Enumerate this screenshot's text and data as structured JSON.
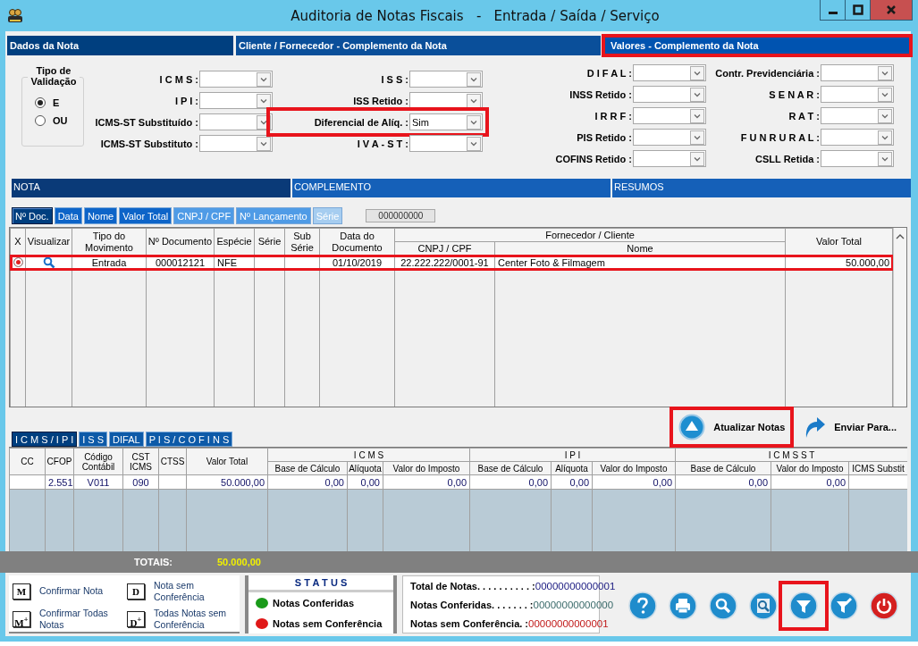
{
  "window": {
    "title": "Auditoria de Notas Fiscais   -   Entrada / Saída / Serviço"
  },
  "sections": [
    {
      "label": "Dados da Nota",
      "highlighted": false
    },
    {
      "label": "Cliente / Fornecedor - Complemento da Nota",
      "highlighted": false
    },
    {
      "label": "Valores - Complemento da Nota",
      "highlighted": true
    }
  ],
  "validation": {
    "title": "Tipo de Validação",
    "options": [
      {
        "label": "E",
        "selected": true
      },
      {
        "label": "OU",
        "selected": false
      }
    ]
  },
  "filters": [
    [
      {
        "label": "I C M S :",
        "highlighted": false
      },
      {
        "label": "I P I :",
        "highlighted": false
      },
      {
        "label": "ICMS-ST Substituído :",
        "highlighted": false
      },
      {
        "label": "ICMS-ST Substituto :",
        "highlighted": false
      }
    ],
    [
      {
        "label": "I S S :",
        "highlighted": false
      },
      {
        "label": "ISS Retido :",
        "highlighted": false
      },
      {
        "label": "Diferencial de Alíq. :",
        "value": "Sim",
        "highlighted": true
      },
      {
        "label": "I V A - S T :",
        "highlighted": false
      }
    ],
    [
      {
        "label": "D I F A L :",
        "highlighted": false
      },
      {
        "label": "INSS Retido :",
        "highlighted": false
      },
      {
        "label": "I R R F :",
        "highlighted": false
      },
      {
        "label": "PIS Retido :",
        "highlighted": false
      },
      {
        "label": "COFINS Retido :",
        "highlighted": false
      }
    ],
    [
      {
        "label": "Contr. Previdenciária :",
        "highlighted": false
      },
      {
        "label": "S E N A R :",
        "highlighted": false
      },
      {
        "label": "R A T :",
        "highlighted": false
      },
      {
        "label": "F U N R U R A L :",
        "highlighted": false
      },
      {
        "label": "CSLL Retida :",
        "highlighted": false
      }
    ]
  ],
  "result_tabs": [
    {
      "label": "NOTA",
      "selected": true
    },
    {
      "label": "COMPLEMENTO",
      "selected": false
    },
    {
      "label": "RESUMOS",
      "selected": false
    }
  ],
  "sort_tabs": [
    {
      "label": "Nº Doc.",
      "selected": true,
      "color": "#003f7f"
    },
    {
      "label": "Data",
      "selected": false,
      "color": "#0d64c8"
    },
    {
      "label": "Nome",
      "selected": false,
      "color": "#0d64c8"
    },
    {
      "label": "Valor Total",
      "selected": false,
      "color": "#0d64c8"
    },
    {
      "label": "CNPJ / CPF",
      "selected": false,
      "color": "#4f9be6"
    },
    {
      "label": "Nº Lançamento",
      "selected": false,
      "color": "#4f9be6"
    },
    {
      "label": "Série",
      "selected": false,
      "color": "#a6cdf0"
    }
  ],
  "sort_field": {
    "value": "000000000"
  },
  "grid": {
    "columns": [
      {
        "header": "X",
        "kind": "radio"
      },
      {
        "header": "Visualizar",
        "kind": "icon"
      },
      {
        "header": "Tipo do Movimento",
        "kind": "text"
      },
      {
        "header": "Nº Documento",
        "kind": "text"
      },
      {
        "header": "Espécie",
        "kind": "name"
      },
      {
        "header": "Série",
        "kind": "text"
      },
      {
        "header": "Sub Série",
        "kind": "text"
      },
      {
        "header": "Data do Documento",
        "kind": "text"
      },
      {
        "header": "Fornecedor / Cliente",
        "colspan": 2,
        "children": [
          {
            "header": "CNPJ / CPF",
            "kind": "text"
          },
          {
            "header": "Nome",
            "kind": "name"
          }
        ]
      },
      {
        "header": "Valor Total",
        "kind": "number"
      }
    ],
    "rows": [
      {
        "selected": true,
        "highlighted": true,
        "cells": [
          null,
          null,
          "Entrada",
          "000012121",
          "NFE",
          null,
          null,
          "01/10/2019",
          "22.222.222/0001-91",
          "Center Foto & Filmagem",
          "50.000,00"
        ]
      }
    ]
  },
  "actions": [
    {
      "label": "Atualizar Notas",
      "kind": "refresh",
      "highlighted": true
    },
    {
      "label": "Enviar Para...",
      "kind": "send",
      "highlighted": false
    }
  ],
  "tax_tabs": [
    {
      "label": "I C M S / I P I",
      "selected": true
    },
    {
      "label": "I S S",
      "selected": false
    },
    {
      "label": "DIFAL",
      "selected": false
    },
    {
      "label": "P I S / C O F I N S",
      "selected": false
    }
  ],
  "tax_grid": {
    "columns": [
      {
        "header": "CC",
        "kind": "text"
      },
      {
        "header": "CFOP",
        "kind": "number"
      },
      {
        "header": "Código Contábil",
        "kind": "text"
      },
      {
        "header": "CST ICMS",
        "kind": "text"
      },
      {
        "header": "CTSS",
        "kind": "text"
      },
      {
        "header": "Valor Total",
        "kind": "number"
      },
      {
        "header": "I C M S",
        "colspan": 3,
        "children": [
          {
            "header": "Base de Cálculo",
            "kind": "number"
          },
          {
            "header": "Alíquota",
            "kind": "number"
          },
          {
            "header": "Valor do Imposto",
            "kind": "number"
          }
        ]
      },
      {
        "header": "I P I",
        "colspan": 3,
        "children": [
          {
            "header": "Base de Cálculo",
            "kind": "number"
          },
          {
            "header": "Alíquota",
            "kind": "number"
          },
          {
            "header": "Valor do Imposto",
            "kind": "number"
          }
        ]
      },
      {
        "header": "I C M S   S T",
        "colspan": 3,
        "children": [
          {
            "header": "Base de Cálculo",
            "kind": "number"
          },
          {
            "header": "Valor do Imposto",
            "kind": "number"
          },
          {
            "header": "ICMS Substit",
            "kind": "number"
          }
        ]
      }
    ],
    "rows": [
      {
        "cells": [
          null,
          "2.551",
          "V011",
          "090",
          null,
          "50.000,00",
          "0,00",
          "0,00",
          "0,00",
          "0,00",
          "0,00",
          "0,00",
          "0,00",
          "0,00",
          null
        ]
      }
    ]
  },
  "totals": {
    "label": "TOTAIS:",
    "value": "50.000,00"
  },
  "legend": [
    {
      "key": "M",
      "label": "Confirmar Nota"
    },
    {
      "key": "M$^{+}$",
      "label": "Confirmar Todas Notas"
    },
    {
      "key": "D",
      "label": "Nota sem Conferência"
    },
    {
      "key": "D$^{+}$",
      "label": "Todas Notas sem Conferência"
    }
  ],
  "status": {
    "title": "S T A T U S",
    "items": [
      {
        "label": "Notas Conferidas",
        "color": "#1a9a1a"
      },
      {
        "label": "Notas sem Conferência",
        "color": "#e01818"
      }
    ]
  },
  "counts": [
    {
      "label": "Total de Notas. . . . . . . . . . :",
      "value": "00000000000001",
      "color": "#1a1a80"
    },
    {
      "label": "Notas Conferidas. . . . . . . :",
      "value": "00000000000000",
      "color": "#3a6a6a"
    },
    {
      "label": "Notas sem Conferência. :",
      "value": "00000000000001",
      "color": "#c01818"
    }
  ],
  "toolbar": [
    {
      "kind": "help",
      "highlighted": false
    },
    {
      "kind": "print",
      "highlighted": false
    },
    {
      "kind": "search",
      "highlighted": false
    },
    {
      "kind": "preview",
      "highlighted": false
    },
    {
      "kind": "filter",
      "highlighted": true
    },
    {
      "kind": "clear-filter",
      "highlighted": false
    },
    {
      "kind": "power",
      "highlighted": false
    }
  ]
}
